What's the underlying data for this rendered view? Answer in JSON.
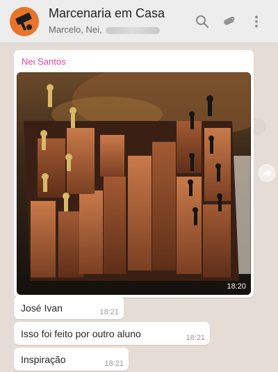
{
  "header": {
    "title": "Marcenaria em Casa",
    "subtitle": "Marcelo, Nei,",
    "icons": [
      "search-icon",
      "attach-icon",
      "more-vertical-icon"
    ],
    "avatar_color": "#e8742a"
  },
  "messages": [
    {
      "type": "image",
      "sender": "Nei Santos",
      "sender_color": "#e542a3",
      "time": "18:20"
    },
    {
      "type": "text",
      "text": "José Ivan",
      "time": "18:21"
    },
    {
      "type": "text",
      "text": "Isso foi feito por outro aluno",
      "time": "18:21"
    },
    {
      "type": "text",
      "text": "Inspiração",
      "time": "18:21"
    }
  ],
  "colors": {
    "header_bg": "#ededed",
    "chat_bg": "#e5ddd5",
    "bubble_bg": "#ffffff"
  }
}
